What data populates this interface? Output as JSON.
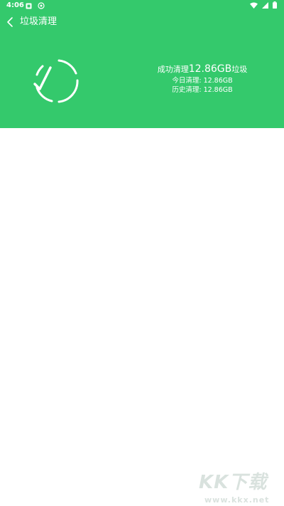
{
  "status_bar": {
    "time": "4:06",
    "left_icons": [
      "notification-box-icon",
      "notification-circle-icon"
    ],
    "right_icons": [
      "wifi-icon",
      "signal-icon",
      "battery-icon"
    ]
  },
  "toolbar": {
    "back_icon": "chevron-left-icon",
    "title": "垃圾清理"
  },
  "result": {
    "headline_prefix": "成功清理",
    "headline_amount": "12.86GB",
    "headline_suffix": "垃圾",
    "today_label": "今日清理: ",
    "today_value": "12.86GB",
    "history_label": "历史清理: ",
    "history_value": "12.86GB"
  },
  "watermark": {
    "main": "KK下载",
    "sub": "www.kkx.net"
  },
  "colors": {
    "header_bg": "#34c96c",
    "text_on_header": "#ffffff",
    "body_bg": "#ffffff"
  }
}
